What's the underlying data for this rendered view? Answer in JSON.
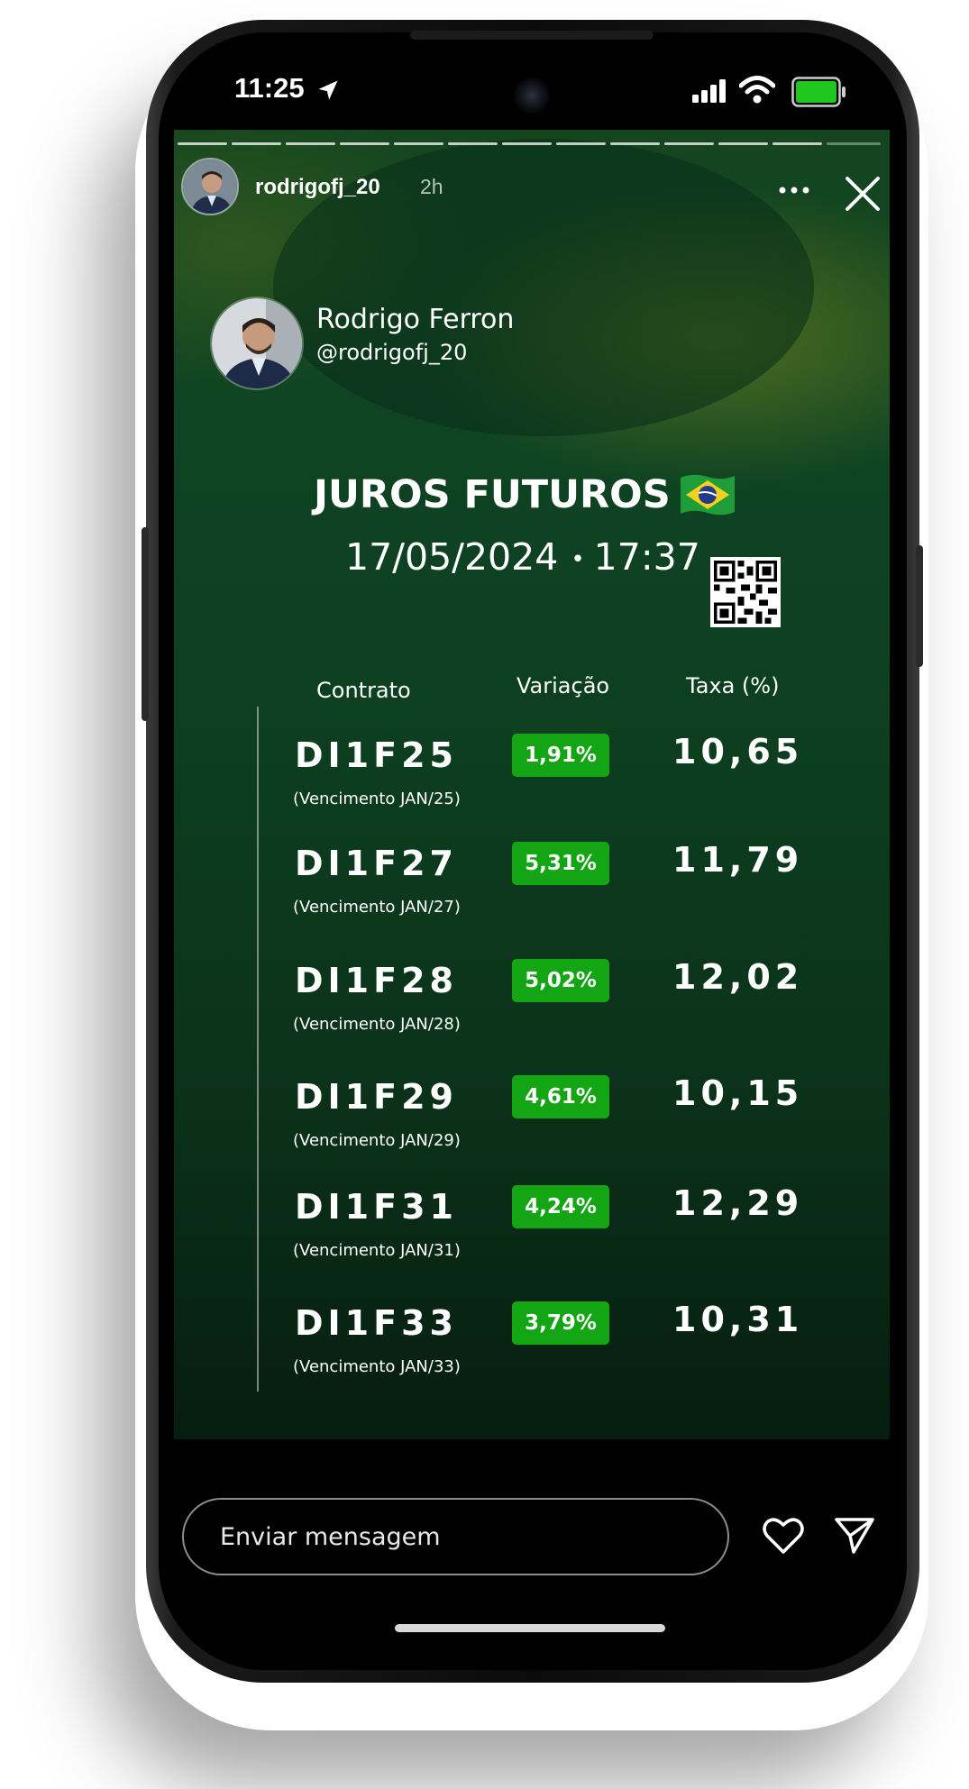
{
  "status_bar": {
    "time": "11:25",
    "icons": [
      "location-arrow-icon",
      "signal-icon",
      "wifi-icon",
      "battery-icon"
    ],
    "battery_color": "#1fc71f"
  },
  "story_header": {
    "username": "rodrigofj_20",
    "time_ago": "2h",
    "progress_segments": 13
  },
  "author": {
    "name": "Rodrigo Ferron",
    "handle": "@rodrigofj_20"
  },
  "headline": {
    "title": "JUROS FUTUROS",
    "date": "17/05/2024",
    "separator": "•",
    "time": "17:37"
  },
  "columns": {
    "contract": "Contrato",
    "variation": "Variação",
    "rate": "Taxa (%)"
  },
  "contracts": [
    {
      "code": "DI1F25",
      "maturity": "(Vencimento JAN/25)",
      "variation": "1,91%",
      "rate": "10,65"
    },
    {
      "code": "DI1F27",
      "maturity": "(Vencimento JAN/27)",
      "variation": "5,31%",
      "rate": "11,79"
    },
    {
      "code": "DI1F28",
      "maturity": "(Vencimento JAN/28)",
      "variation": "5,02%",
      "rate": "12,02"
    },
    {
      "code": "DI1F29",
      "maturity": "(Vencimento JAN/29)",
      "variation": "4,61%",
      "rate": "10,15"
    },
    {
      "code": "DI1F31",
      "maturity": "(Vencimento JAN/31)",
      "variation": "4,24%",
      "rate": "12,29"
    },
    {
      "code": "DI1F33",
      "maturity": "(Vencimento JAN/33)",
      "variation": "3,79%",
      "rate": "10,31"
    }
  ],
  "colors": {
    "badge_green": "#14a514",
    "background_green": "#0d3f20"
  },
  "footer": {
    "message_placeholder": "Enviar mensagem"
  }
}
